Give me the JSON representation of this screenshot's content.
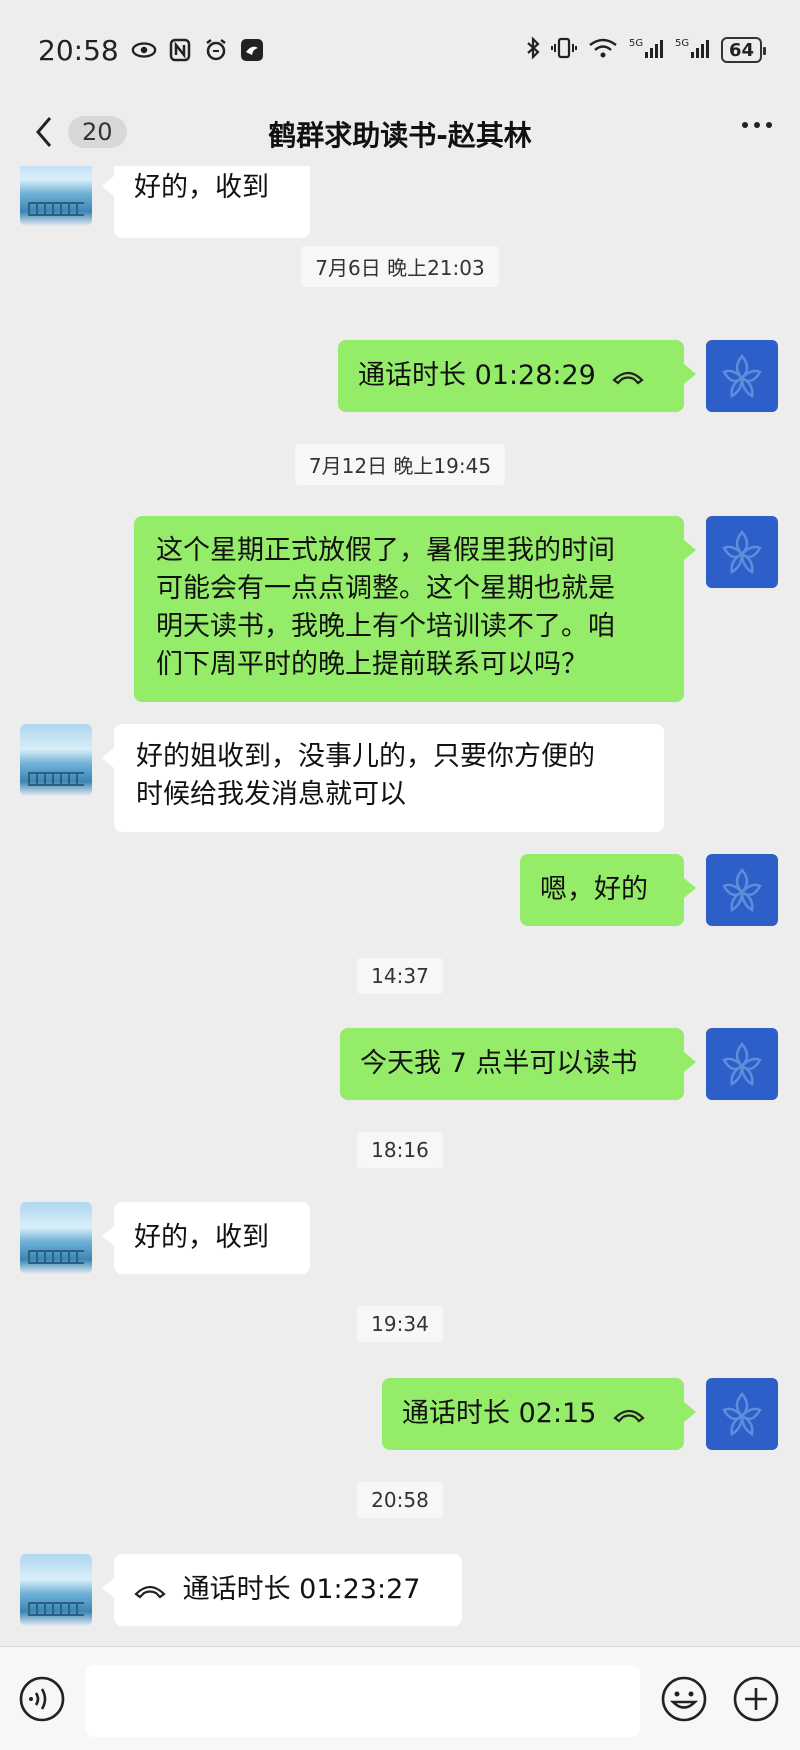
{
  "status_bar": {
    "time": "20:58",
    "battery": "64",
    "icons_left": [
      "eye-icon",
      "nfc-icon",
      "alarm-icon",
      "app-notification-icon"
    ],
    "icons_right": [
      "bluetooth-icon",
      "vibrate-icon",
      "wifi-icon",
      "signal-5g-icon",
      "signal-5g-icon"
    ]
  },
  "header": {
    "unread_count": "20",
    "title": "鹤群求助读书-赵其林"
  },
  "messages": [
    {
      "type": "message",
      "sender": "other",
      "text": "好的，收到"
    },
    {
      "type": "timestamp",
      "text": "7月6日 晚上21:03"
    },
    {
      "type": "call",
      "sender": "self",
      "text": "通话时长 01:28:29"
    },
    {
      "type": "timestamp",
      "text": "7月12日 晚上19:45"
    },
    {
      "type": "message",
      "sender": "self",
      "lines": [
        "这个星期正式放假了，暑假里我的时间",
        "可能会有一点点调整。这个星期也就是",
        "明天读书，我晚上有个培训读不了。咱",
        "们下周平时的晚上提前联系可以吗？"
      ]
    },
    {
      "type": "message",
      "sender": "other",
      "lines": [
        "好的姐收到，没事儿的，只要你方便的",
        "时候给我发消息就可以"
      ]
    },
    {
      "type": "message",
      "sender": "self",
      "text": "嗯，好的"
    },
    {
      "type": "timestamp",
      "text": "14:37"
    },
    {
      "type": "message",
      "sender": "self",
      "text": "今天我 7 点半可以读书"
    },
    {
      "type": "timestamp",
      "text": "18:16"
    },
    {
      "type": "message",
      "sender": "other",
      "text": "好的，收到"
    },
    {
      "type": "timestamp",
      "text": "19:34"
    },
    {
      "type": "call",
      "sender": "self",
      "text": "通话时长 02:15"
    },
    {
      "type": "timestamp",
      "text": "20:58"
    },
    {
      "type": "call",
      "sender": "other",
      "text": "通话时长 01:23:27"
    }
  ],
  "input_bar": {
    "placeholder": ""
  },
  "colors": {
    "self_bubble": "#95ec69",
    "other_bubble": "#ffffff",
    "background": "#ededed",
    "self_avatar": "#2e5fc9"
  }
}
